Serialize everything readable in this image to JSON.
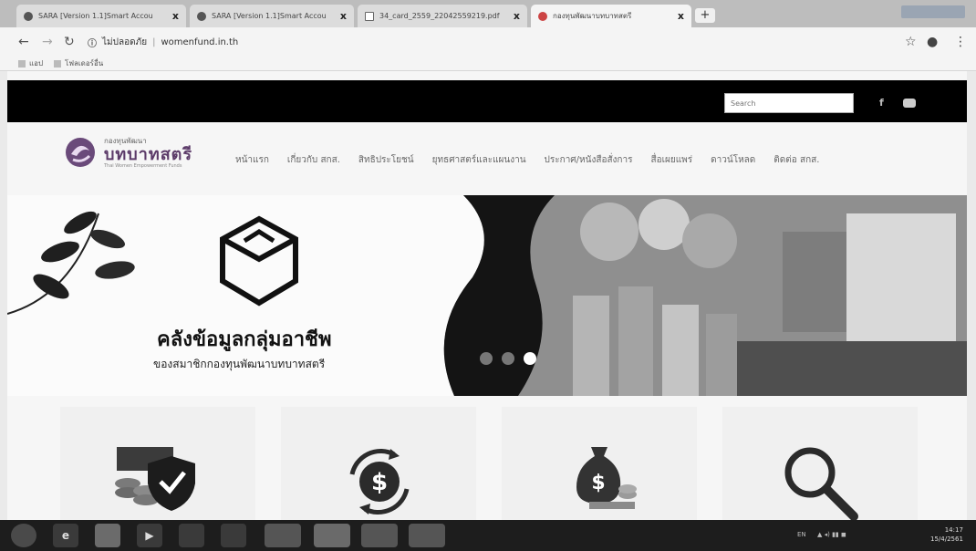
{
  "browser": {
    "tabs": [
      {
        "title": "SARA [Version 1.1]Smart Accou",
        "favicon": "chrome-icon"
      },
      {
        "title": "SARA [Version 1.1]Smart Accou",
        "favicon": "chrome-icon"
      },
      {
        "title": "34_card_2559_22042559219.pdf",
        "favicon": "document-icon"
      },
      {
        "title": "กองทุนพัฒนาบทบาทสตรี",
        "favicon": "site-icon"
      }
    ],
    "close_glyph": "x",
    "new_tab_glyph": "+",
    "address": {
      "security": "ไม่ปลอดภัย",
      "url": "womenfund.in.th"
    },
    "bookmarks": [
      {
        "label": "แอป"
      },
      {
        "label": "โฟลเดอร์อื่น"
      }
    ]
  },
  "site": {
    "search_placeholder": "Search",
    "social": {
      "facebook": "f"
    },
    "logo": {
      "line1": "กองทุนพัฒนา",
      "line2": "บทบาทสตรี",
      "line3": "Thai Women Empowerment Funds"
    },
    "menu": [
      "หน้าแรก",
      "เกี่ยวกับ สกส.",
      "สิทธิประโยชน์",
      "ยุทธศาสตร์และแผนงาน",
      "ประกาศ/หนังสือสั่งการ",
      "สื่อเผยแพร่",
      "ดาวน์โหลด",
      "ติดต่อ สกส."
    ],
    "banner": {
      "title": "คลังข้อมูลกลุ่มอาชีพ",
      "subtitle": "ของสมาชิกกองทุนพัฒนาบทบาทสตรี",
      "slides": 3,
      "active_slide": 3
    },
    "cards": [
      {
        "icon": "coins-shield-icon"
      },
      {
        "icon": "money-exchange-icon"
      },
      {
        "icon": "money-bag-icon"
      },
      {
        "icon": "magnifier-icon"
      }
    ]
  },
  "taskbar": {
    "apps": [
      "start-icon",
      "ie-icon",
      "explorer-icon",
      "media-icon",
      "paint-icon",
      "antivirus-icon",
      "excel-icon",
      "chrome-icon",
      "word-icon",
      "line-icon"
    ],
    "tray": {
      "lang": "EN",
      "time": "14:17",
      "date": "15/4/2561"
    }
  }
}
